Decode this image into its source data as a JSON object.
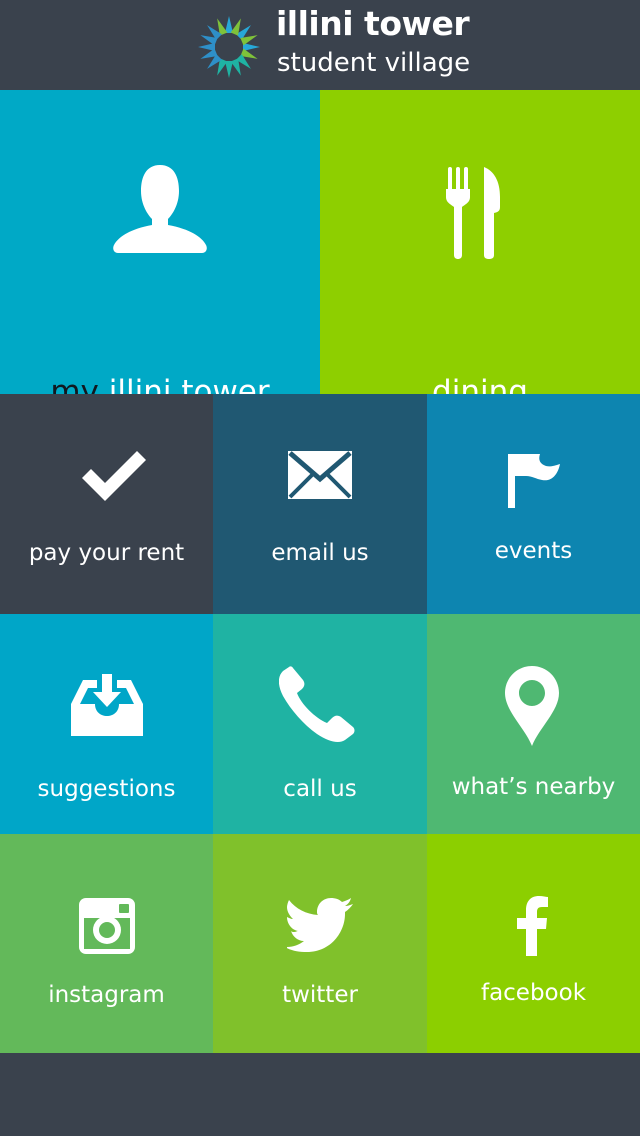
{
  "header": {
    "title": "illini tower",
    "subtitle": "student village",
    "logo_icon": "starburst-logo-icon"
  },
  "colors": {
    "header_bg": "#3a424d",
    "my_illini_tower": "#00a9c6",
    "dining": "#8ecf00",
    "pay_rent": "#3a424d",
    "email_us": "#205872",
    "events": "#0d85b0",
    "suggestions": "#00a6c8",
    "call_us": "#1fb3a3",
    "whats_nearby": "#4fb872",
    "instagram": "#63b95a",
    "twitter": "#80c12b",
    "facebook": "#8ccf00"
  },
  "tiles": {
    "my_illini_tower": {
      "label_my": "my",
      "label_rest": "illini tower",
      "icon": "person-icon"
    },
    "dining": {
      "label": "dining",
      "icon": "fork-knife-icon"
    },
    "pay_rent": {
      "label": "pay your rent",
      "icon": "checkmark-icon"
    },
    "email_us": {
      "label": "email us",
      "icon": "envelope-icon"
    },
    "events": {
      "label": "events",
      "icon": "flag-icon"
    },
    "suggestions": {
      "label": "suggestions",
      "icon": "inbox-download-icon"
    },
    "call_us": {
      "label": "call us",
      "icon": "phone-icon"
    },
    "whats_nearby": {
      "label": "what’s nearby",
      "icon": "map-pin-icon"
    },
    "instagram": {
      "label": "instagram",
      "icon": "instagram-icon"
    },
    "twitter": {
      "label": "twitter",
      "icon": "twitter-bird-icon"
    },
    "facebook": {
      "label": "facebook",
      "icon": "facebook-icon"
    }
  }
}
